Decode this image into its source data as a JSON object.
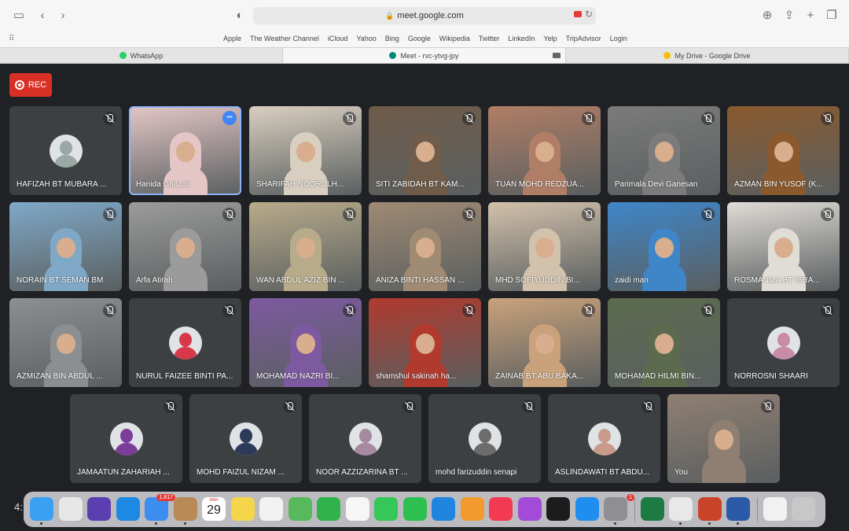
{
  "browser": {
    "url": "meet.google.com",
    "favorites": [
      "Apple",
      "The Weather Channel",
      "iCloud",
      "Yahoo",
      "Bing",
      "Google",
      "Wikipedia",
      "Twitter",
      "LinkedIn",
      "Yelp",
      "TripAdvisor",
      "Login"
    ],
    "tabs": [
      {
        "title": "WhatsApp",
        "icon": "whatsapp-icon",
        "color": "#25d366"
      },
      {
        "title": "Meet - rvc-ytvg-jpy",
        "icon": "meet-icon",
        "color": "#00897b"
      },
      {
        "title": "My Drive - Google Drive",
        "icon": "drive-icon",
        "color": "#fbbc04"
      }
    ]
  },
  "meet": {
    "rec_label": "REC",
    "participants": [
      {
        "name": "HAFIZAH BT MUBARA ...",
        "type": "avatar",
        "color": "#9aa7a3"
      },
      {
        "name": "Hanida Ghazali",
        "type": "video",
        "color": "#e4c6c6",
        "speaking": true
      },
      {
        "name": "SHARIFAH NOORULH...",
        "type": "video",
        "color": "#d9cfc0"
      },
      {
        "name": "SITI ZABIDAH BT KAM...",
        "type": "video",
        "color": "#6f5c4a"
      },
      {
        "name": "TUAN MOHD REDZUA...",
        "type": "video",
        "color": "#b07e66"
      },
      {
        "name": "Parimala Devi Ganesan",
        "type": "video",
        "color": "#7b7b7b"
      },
      {
        "name": "AZMAN BIN YUSOF (K...",
        "type": "video",
        "color": "#8a5a2e"
      },
      {
        "name": "NORAIN BT SEMAN BM",
        "type": "video",
        "color": "#7fa8c7"
      },
      {
        "name": "Arfa Atirah",
        "type": "video",
        "color": "#9b9b9b"
      },
      {
        "name": "WAN ABDUL AZIZ BIN ...",
        "type": "video",
        "color": "#b8ab8a"
      },
      {
        "name": "ANIZA BINTI HASSAN ...",
        "type": "video",
        "color": "#9f8a73"
      },
      {
        "name": "MHD SOFIYUDDIN BI...",
        "type": "video",
        "color": "#d2c1ab"
      },
      {
        "name": "zaidi man",
        "type": "video",
        "color": "#3f86c8"
      },
      {
        "name": "ROSMANIZA BT IBRA...",
        "type": "video",
        "color": "#e0dcd6"
      },
      {
        "name": "AZMIZAN BIN ABDUL ...",
        "type": "video",
        "color": "#8c8f92"
      },
      {
        "name": "NURUL FAIZEE BINTI PA...",
        "type": "avatar",
        "color": "#d8394a"
      },
      {
        "name": "MOHAMAD NAZRI BI...",
        "type": "video",
        "color": "#7d5aa0"
      },
      {
        "name": "shamshul sakinah ha...",
        "type": "video",
        "color": "#b03a2e"
      },
      {
        "name": "ZAINAB BT ABU BAKA...",
        "type": "video",
        "color": "#c9a27b"
      },
      {
        "name": "MOHAMAD HILMI BIN...",
        "type": "video",
        "color": "#5c6b4e"
      },
      {
        "name": "NORROSNI SHAARI",
        "type": "avatar",
        "color": "#c88ca8"
      },
      {
        "name": "JAMAATUN ZAHARIAH ...",
        "type": "avatar",
        "color": "#7a3e9a"
      },
      {
        "name": "MOHD FAIZUL NIZAM ...",
        "type": "avatar",
        "color": "#2d3a5a"
      },
      {
        "name": "NOOR AZZIZARINA BT ...",
        "type": "avatar",
        "color": "#a58aa2"
      },
      {
        "name": "mohd farizuddin senapi",
        "type": "avatar",
        "color": "#6c6c6c"
      },
      {
        "name": "ASLINDAWATI BT ABDU...",
        "type": "avatar",
        "color": "#c89a8a"
      },
      {
        "name": "You",
        "type": "video",
        "color": "#8f7f73"
      }
    ]
  },
  "clock": "4:",
  "dock": {
    "apps": [
      {
        "name": "finder-icon",
        "color": "#3aa0f3"
      },
      {
        "name": "launchpad-icon",
        "color": "#e7e7e7"
      },
      {
        "name": "siri-icon",
        "color": "#5b3fb0"
      },
      {
        "name": "safari-icon",
        "color": "#1e88e5"
      },
      {
        "name": "mail-icon",
        "color": "#3b8ef0",
        "badge": "1,817"
      },
      {
        "name": "contacts-icon",
        "color": "#b98a55"
      },
      {
        "name": "calendar-icon",
        "color": "#ffffff",
        "month": "MAR",
        "day": "29"
      },
      {
        "name": "notes-icon",
        "color": "#f5d54a"
      },
      {
        "name": "reminders-icon",
        "color": "#f2f2f2"
      },
      {
        "name": "maps-icon",
        "color": "#58b85c"
      },
      {
        "name": "numbers-icon",
        "color": "#2fb34a"
      },
      {
        "name": "photos-icon",
        "color": "#f6f6f6"
      },
      {
        "name": "messages-icon",
        "color": "#35c759"
      },
      {
        "name": "facetime-icon",
        "color": "#2dbf4f"
      },
      {
        "name": "keynote-icon",
        "color": "#1f86e0"
      },
      {
        "name": "pages-icon",
        "color": "#f29a2e"
      },
      {
        "name": "music-icon",
        "color": "#f23a55"
      },
      {
        "name": "podcasts-icon",
        "color": "#a24bd8"
      },
      {
        "name": "appletv-icon",
        "color": "#1c1c1c"
      },
      {
        "name": "appstore-icon",
        "color": "#1e8ef0"
      },
      {
        "name": "system-preferences-icon",
        "color": "#8e8e93",
        "badge": "1"
      },
      {
        "name": "excel-icon",
        "color": "#1d7a43"
      },
      {
        "name": "chrome-icon",
        "color": "#e8e8e8"
      },
      {
        "name": "powerpoint-icon",
        "color": "#c9432a"
      },
      {
        "name": "word-icon",
        "color": "#2b5aa8"
      },
      {
        "name": "document-icon",
        "color": "#f1f1f1"
      },
      {
        "name": "trash-icon",
        "color": "#c7c7c7"
      }
    ]
  }
}
